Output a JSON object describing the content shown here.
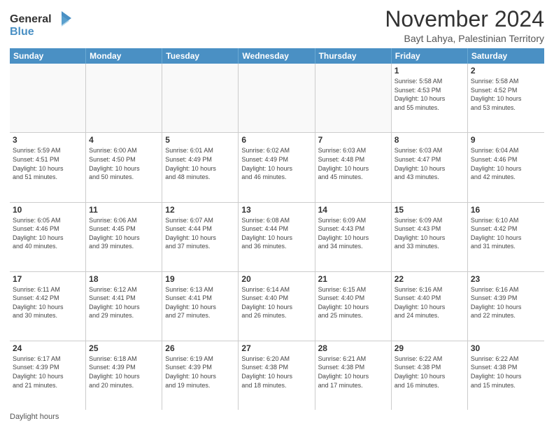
{
  "logo": {
    "line1": "General",
    "line2": "Blue"
  },
  "title": "November 2024",
  "subtitle": "Bayt Lahya, Palestinian Territory",
  "days_of_week": [
    "Sunday",
    "Monday",
    "Tuesday",
    "Wednesday",
    "Thursday",
    "Friday",
    "Saturday"
  ],
  "footer": "Daylight hours",
  "weeks": [
    [
      {
        "day": "",
        "info": "",
        "empty": true
      },
      {
        "day": "",
        "info": "",
        "empty": true
      },
      {
        "day": "",
        "info": "",
        "empty": true
      },
      {
        "day": "",
        "info": "",
        "empty": true
      },
      {
        "day": "",
        "info": "",
        "empty": true
      },
      {
        "day": "1",
        "info": "Sunrise: 5:58 AM\nSunset: 4:53 PM\nDaylight: 10 hours\nand 55 minutes.",
        "empty": false
      },
      {
        "day": "2",
        "info": "Sunrise: 5:58 AM\nSunset: 4:52 PM\nDaylight: 10 hours\nand 53 minutes.",
        "empty": false
      }
    ],
    [
      {
        "day": "3",
        "info": "Sunrise: 5:59 AM\nSunset: 4:51 PM\nDaylight: 10 hours\nand 51 minutes.",
        "empty": false
      },
      {
        "day": "4",
        "info": "Sunrise: 6:00 AM\nSunset: 4:50 PM\nDaylight: 10 hours\nand 50 minutes.",
        "empty": false
      },
      {
        "day": "5",
        "info": "Sunrise: 6:01 AM\nSunset: 4:49 PM\nDaylight: 10 hours\nand 48 minutes.",
        "empty": false
      },
      {
        "day": "6",
        "info": "Sunrise: 6:02 AM\nSunset: 4:49 PM\nDaylight: 10 hours\nand 46 minutes.",
        "empty": false
      },
      {
        "day": "7",
        "info": "Sunrise: 6:03 AM\nSunset: 4:48 PM\nDaylight: 10 hours\nand 45 minutes.",
        "empty": false
      },
      {
        "day": "8",
        "info": "Sunrise: 6:03 AM\nSunset: 4:47 PM\nDaylight: 10 hours\nand 43 minutes.",
        "empty": false
      },
      {
        "day": "9",
        "info": "Sunrise: 6:04 AM\nSunset: 4:46 PM\nDaylight: 10 hours\nand 42 minutes.",
        "empty": false
      }
    ],
    [
      {
        "day": "10",
        "info": "Sunrise: 6:05 AM\nSunset: 4:46 PM\nDaylight: 10 hours\nand 40 minutes.",
        "empty": false
      },
      {
        "day": "11",
        "info": "Sunrise: 6:06 AM\nSunset: 4:45 PM\nDaylight: 10 hours\nand 39 minutes.",
        "empty": false
      },
      {
        "day": "12",
        "info": "Sunrise: 6:07 AM\nSunset: 4:44 PM\nDaylight: 10 hours\nand 37 minutes.",
        "empty": false
      },
      {
        "day": "13",
        "info": "Sunrise: 6:08 AM\nSunset: 4:44 PM\nDaylight: 10 hours\nand 36 minutes.",
        "empty": false
      },
      {
        "day": "14",
        "info": "Sunrise: 6:09 AM\nSunset: 4:43 PM\nDaylight: 10 hours\nand 34 minutes.",
        "empty": false
      },
      {
        "day": "15",
        "info": "Sunrise: 6:09 AM\nSunset: 4:43 PM\nDaylight: 10 hours\nand 33 minutes.",
        "empty": false
      },
      {
        "day": "16",
        "info": "Sunrise: 6:10 AM\nSunset: 4:42 PM\nDaylight: 10 hours\nand 31 minutes.",
        "empty": false
      }
    ],
    [
      {
        "day": "17",
        "info": "Sunrise: 6:11 AM\nSunset: 4:42 PM\nDaylight: 10 hours\nand 30 minutes.",
        "empty": false
      },
      {
        "day": "18",
        "info": "Sunrise: 6:12 AM\nSunset: 4:41 PM\nDaylight: 10 hours\nand 29 minutes.",
        "empty": false
      },
      {
        "day": "19",
        "info": "Sunrise: 6:13 AM\nSunset: 4:41 PM\nDaylight: 10 hours\nand 27 minutes.",
        "empty": false
      },
      {
        "day": "20",
        "info": "Sunrise: 6:14 AM\nSunset: 4:40 PM\nDaylight: 10 hours\nand 26 minutes.",
        "empty": false
      },
      {
        "day": "21",
        "info": "Sunrise: 6:15 AM\nSunset: 4:40 PM\nDaylight: 10 hours\nand 25 minutes.",
        "empty": false
      },
      {
        "day": "22",
        "info": "Sunrise: 6:16 AM\nSunset: 4:40 PM\nDaylight: 10 hours\nand 24 minutes.",
        "empty": false
      },
      {
        "day": "23",
        "info": "Sunrise: 6:16 AM\nSunset: 4:39 PM\nDaylight: 10 hours\nand 22 minutes.",
        "empty": false
      }
    ],
    [
      {
        "day": "24",
        "info": "Sunrise: 6:17 AM\nSunset: 4:39 PM\nDaylight: 10 hours\nand 21 minutes.",
        "empty": false
      },
      {
        "day": "25",
        "info": "Sunrise: 6:18 AM\nSunset: 4:39 PM\nDaylight: 10 hours\nand 20 minutes.",
        "empty": false
      },
      {
        "day": "26",
        "info": "Sunrise: 6:19 AM\nSunset: 4:39 PM\nDaylight: 10 hours\nand 19 minutes.",
        "empty": false
      },
      {
        "day": "27",
        "info": "Sunrise: 6:20 AM\nSunset: 4:38 PM\nDaylight: 10 hours\nand 18 minutes.",
        "empty": false
      },
      {
        "day": "28",
        "info": "Sunrise: 6:21 AM\nSunset: 4:38 PM\nDaylight: 10 hours\nand 17 minutes.",
        "empty": false
      },
      {
        "day": "29",
        "info": "Sunrise: 6:22 AM\nSunset: 4:38 PM\nDaylight: 10 hours\nand 16 minutes.",
        "empty": false
      },
      {
        "day": "30",
        "info": "Sunrise: 6:22 AM\nSunset: 4:38 PM\nDaylight: 10 hours\nand 15 minutes.",
        "empty": false
      }
    ]
  ]
}
